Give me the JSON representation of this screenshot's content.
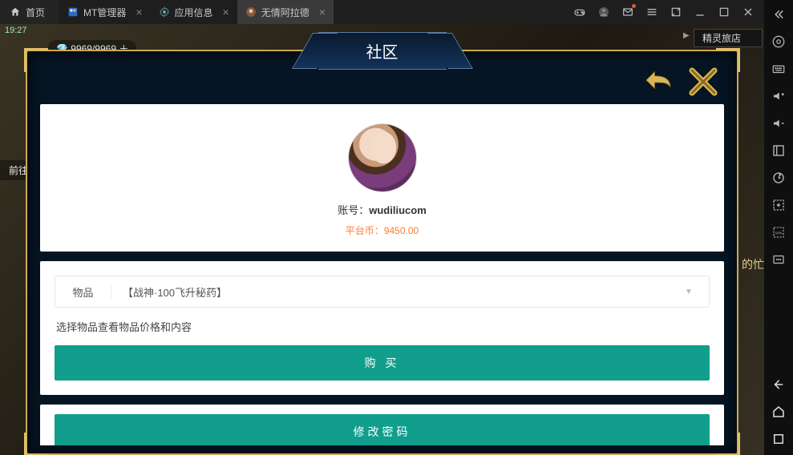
{
  "titlebar": {
    "home": "首页",
    "tabs": [
      {
        "label": "MT管理器",
        "active": false
      },
      {
        "label": "应用信息",
        "active": false
      },
      {
        "label": "无情阿拉德",
        "active": true
      }
    ]
  },
  "hud": {
    "time": "19:27",
    "currency": "9969/9969",
    "dest": "前往",
    "banner": "精灵旅店",
    "right_label": "的忙"
  },
  "dialog": {
    "title": "社区",
    "account_label": "账号：",
    "account_value": "wudiliucom",
    "coin_label": "平台币：",
    "coin_value": "9450.00",
    "item_label": "物品",
    "item_value": "【战神·100飞升秘药】",
    "hint": "选择物品查看物品价格和内容",
    "buy_btn": "购 买",
    "pwd_btn": "修改密码"
  }
}
